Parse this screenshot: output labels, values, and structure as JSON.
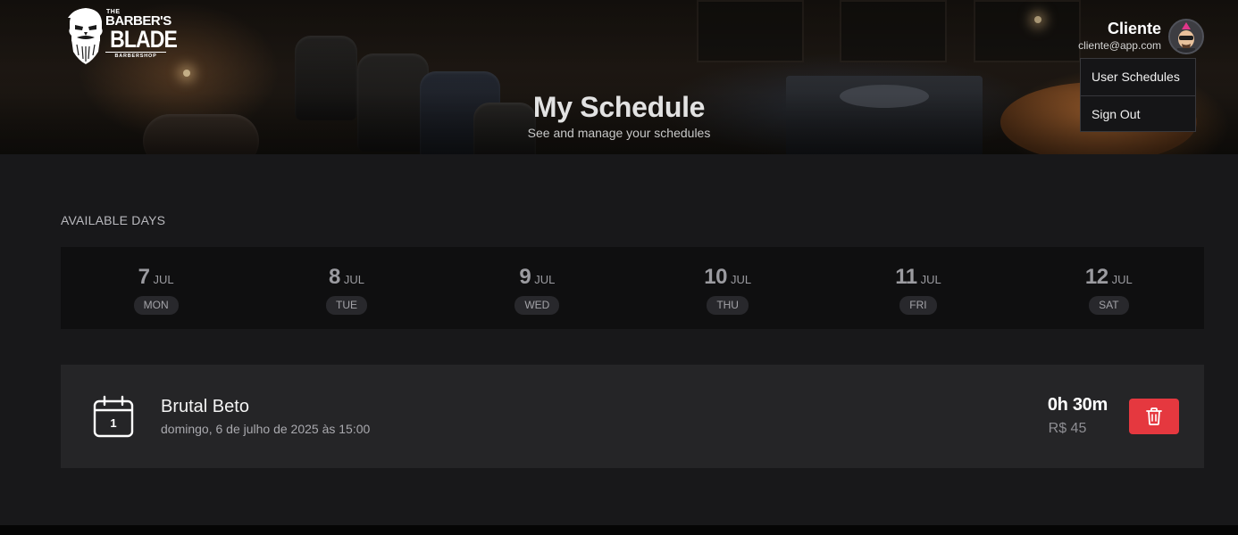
{
  "brand": {
    "the": "THE",
    "barbers": "BARBER'S",
    "blade": "BLADE",
    "barbershop": "BARBERSHOP"
  },
  "header": {
    "title": "My Schedule",
    "subtitle": "See and manage your schedules"
  },
  "user": {
    "name": "Cliente",
    "email": "cliente@app.com",
    "avatar_icon": "punk-avatar-icon"
  },
  "menu": {
    "items": [
      {
        "label": "User Schedules"
      },
      {
        "label": "Sign Out"
      }
    ]
  },
  "available_days": {
    "label": "AVAILABLE DAYS",
    "days": [
      {
        "day": "7",
        "month": "JUL",
        "weekday": "MON"
      },
      {
        "day": "8",
        "month": "JUL",
        "weekday": "TUE"
      },
      {
        "day": "9",
        "month": "JUL",
        "weekday": "WED"
      },
      {
        "day": "10",
        "month": "JUL",
        "weekday": "THU"
      },
      {
        "day": "11",
        "month": "JUL",
        "weekday": "FRI"
      },
      {
        "day": "12",
        "month": "JUL",
        "weekday": "SAT"
      }
    ]
  },
  "appointment": {
    "calendar_day": "1",
    "barber": "Brutal Beto",
    "datetime": "domingo, 6 de julho de 2025 às 15:00",
    "duration": "0h 30m",
    "price": "R$ 45",
    "delete_icon": "trash-icon"
  },
  "colors": {
    "background": "#18181a",
    "days_bar": "#0f0f10",
    "card": "#252527",
    "danger": "#e5383f"
  }
}
